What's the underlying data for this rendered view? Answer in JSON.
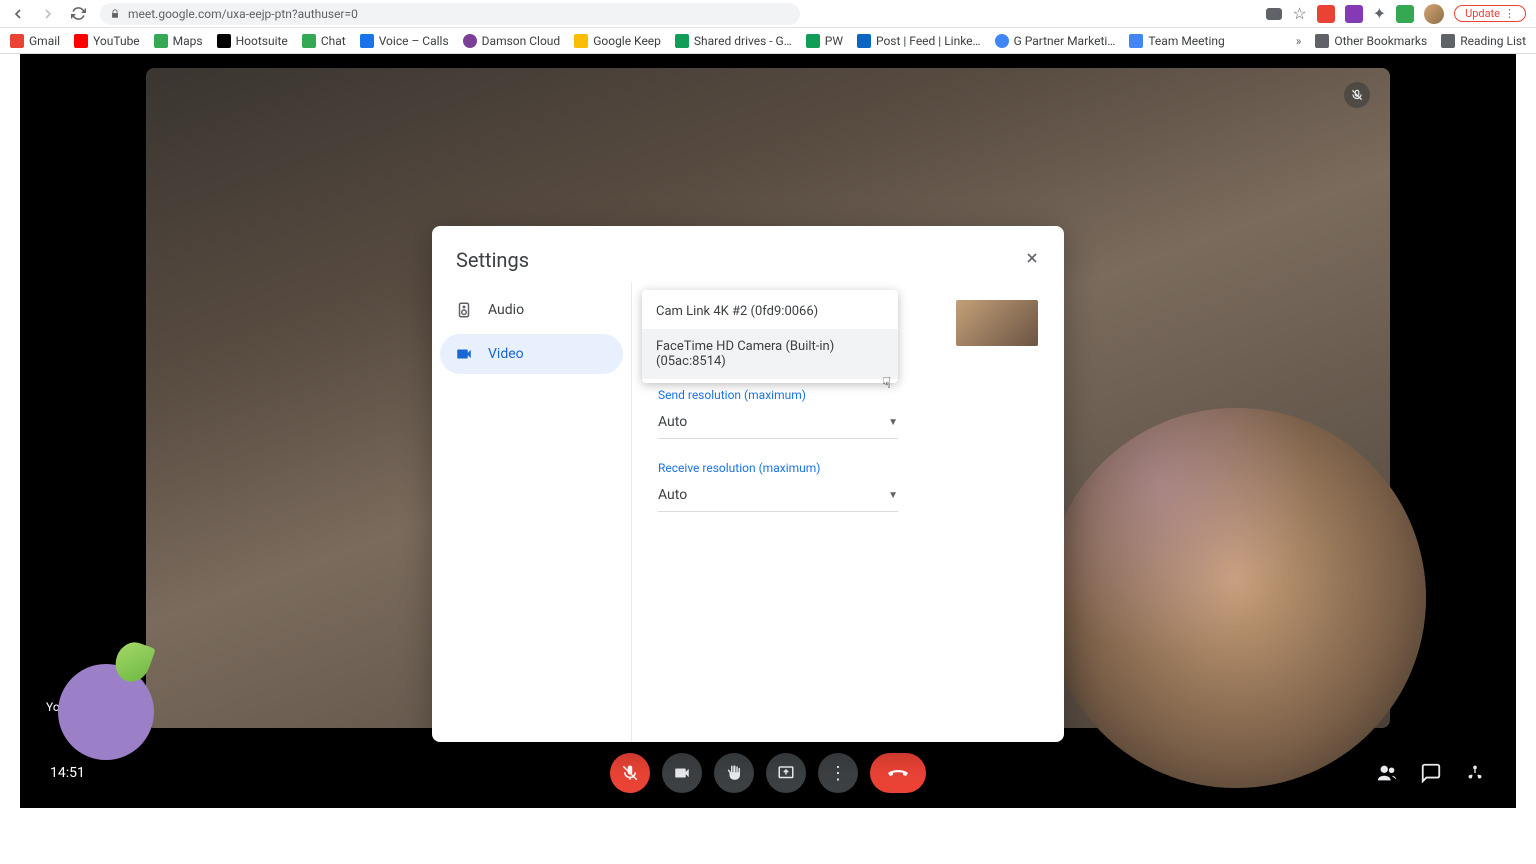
{
  "browser": {
    "url": "meet.google.com/uxa-eejp-ptn?authuser=0",
    "update_label": "Update"
  },
  "bookmarks": {
    "items": [
      {
        "label": "Gmail",
        "color": "#ea4335"
      },
      {
        "label": "YouTube",
        "color": "#ff0000"
      },
      {
        "label": "Maps",
        "color": "#34a853"
      },
      {
        "label": "Hootsuite",
        "color": "#000000"
      },
      {
        "label": "Chat",
        "color": "#34a853"
      },
      {
        "label": "Voice – Calls",
        "color": "#1a73e8"
      },
      {
        "label": "Damson Cloud",
        "color": "#7b3f98"
      },
      {
        "label": "Google Keep",
        "color": "#fbbc04"
      },
      {
        "label": "Shared drives - G…",
        "color": "#0f9d58"
      },
      {
        "label": "PW",
        "color": "#0f9d58"
      },
      {
        "label": "Post | Feed | Linke…",
        "color": "#0a66c2"
      },
      {
        "label": "G Partner Marketi…",
        "color": "#4285f4"
      },
      {
        "label": "Team Meeting",
        "color": "#4285f4"
      }
    ],
    "other": "Other Bookmarks",
    "reading": "Reading List"
  },
  "meet": {
    "time": "14:51",
    "you_label": "You"
  },
  "settings": {
    "title": "Settings",
    "tabs": {
      "audio": "Audio",
      "video": "Video"
    },
    "camera_options": [
      "Cam Link 4K #2 (0fd9:0066)",
      "FaceTime HD Camera (Built-in) (05ac:8514)"
    ],
    "send_res_label": "Send resolution (maximum)",
    "send_res_value": "Auto",
    "recv_res_label": "Receive resolution (maximum)",
    "recv_res_value": "Auto"
  }
}
